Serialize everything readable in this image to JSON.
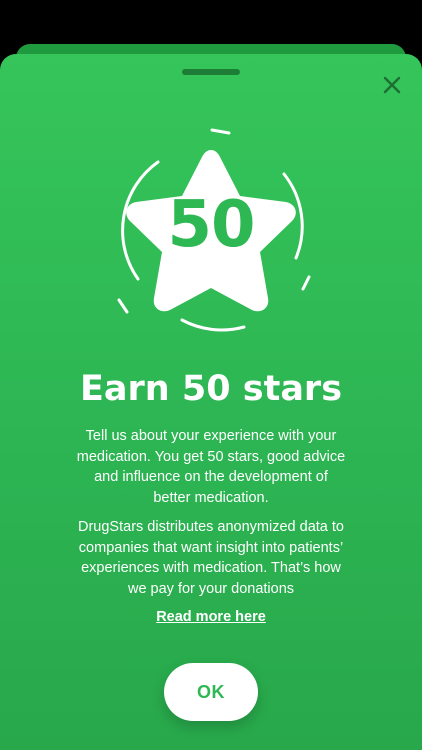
{
  "modal": {
    "star_count": "50",
    "title": "Earn 50 stars",
    "paragraph_1": "Tell us about your experience with your medication. You get 50 stars, good advice and influence on the development of better medication.",
    "paragraph_2": "DrugStars distributes anonymized data to companies that want insight into patients’ experiences with medication. That’s how we pay for your donations",
    "read_more_label": "Read more here",
    "ok_label": "OK",
    "close_icon": "close-icon",
    "hero_icon": "star-badge-icon"
  },
  "colors": {
    "accent": "#2eb853",
    "sheet_background": "#33c058",
    "text": "#ffffff",
    "page_background": "#000000"
  }
}
